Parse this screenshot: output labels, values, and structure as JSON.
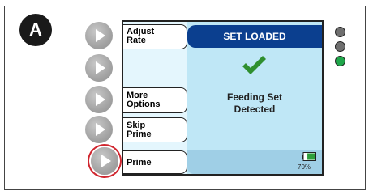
{
  "figure_label": "A",
  "screen": {
    "header": "SET LOADED",
    "message_line1": "Feeding Set",
    "message_line2": "Detected",
    "battery_percent": "70%",
    "battery_level": 0.7
  },
  "softkeys": [
    {
      "line1": "Adjust",
      "line2": "Rate"
    },
    {
      "line1": "More",
      "line2": "Options"
    },
    {
      "line1": "Skip",
      "line2": "Prime"
    },
    {
      "line1": "Prime",
      "line2": ""
    }
  ],
  "colors": {
    "header_bg": "#0b3f8f",
    "screen_bg": "#bfe7f6",
    "check": "#2f8f2f",
    "battery": "#2e9e3a",
    "led_off": "#6f6f6f",
    "led_on": "#1fa64a",
    "highlight_ring": "#d0262f"
  },
  "icons": {
    "check": "check-mark-icon",
    "battery": "battery-icon",
    "button": "play-triangle-icon"
  },
  "indicator_leds": [
    "off",
    "off",
    "on"
  ]
}
